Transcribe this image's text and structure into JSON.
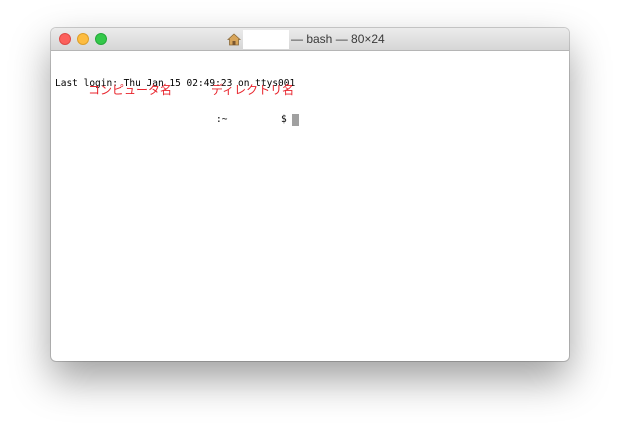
{
  "window": {
    "title_suffix": "— bash — 80×24",
    "controls": {
      "close_color": "#fc605c",
      "minimize_color": "#fdbc40",
      "zoom_color": "#34c84a"
    },
    "title_icon": "home-folder-icon"
  },
  "terminal": {
    "last_login": "Last login: Thu Jan 15 02:49:23 on ttys001",
    "prompt_sep": ":~",
    "prompt_symbol": "$"
  },
  "annotations": {
    "computer_name": "コンピュータ名",
    "directory_name": "ディレクトリ名",
    "color": "#e8242c"
  }
}
